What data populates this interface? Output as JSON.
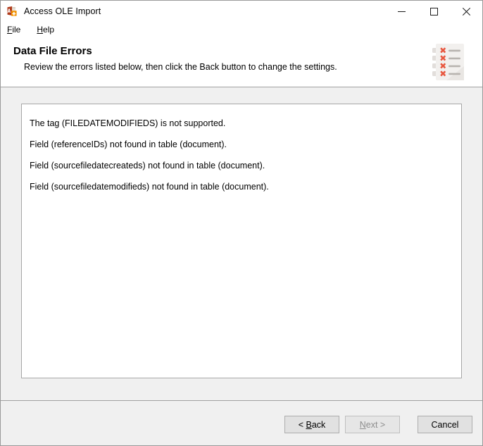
{
  "window": {
    "title": "Access OLE Import",
    "app_icon": "access-app-icon",
    "controls": {
      "minimize": "minimize-icon",
      "maximize": "maximize-icon",
      "close": "close-icon"
    }
  },
  "menubar": {
    "items": [
      {
        "label": "File",
        "accel": "F"
      },
      {
        "label": "Help",
        "accel": "H"
      }
    ]
  },
  "header": {
    "title": "Data File Errors",
    "subtitle": "Review the errors listed below, then click the Back button to change the settings.",
    "icon": "error-list-document-icon"
  },
  "errors": {
    "lines": [
      "The tag (FILEDATEMODIFIEDS) is not supported.",
      "Field (referenceIDs) not found in table (document).",
      "Field (sourcefiledatecreateds) not found in table (document).",
      "Field (sourcefiledatemodifieds) not found in table (document)."
    ]
  },
  "footer": {
    "buttons": [
      {
        "label": "< Back",
        "name": "back-button",
        "enabled": true
      },
      {
        "label": "Next >",
        "name": "next-button",
        "enabled": false
      },
      {
        "label": "Cancel",
        "name": "cancel-button",
        "enabled": true
      }
    ]
  },
  "colors": {
    "window_bg": "#f0f0f0",
    "titlebar_bg": "#ffffff",
    "panel_bg": "#ffffff",
    "panel_border": "#a6a6a6",
    "button_bg": "#e1e1e1",
    "button_border": "#adadad",
    "disabled_text": "#8d8d8d",
    "error_mark": "#e8573f",
    "icon_paper": "#f2f0ee"
  }
}
